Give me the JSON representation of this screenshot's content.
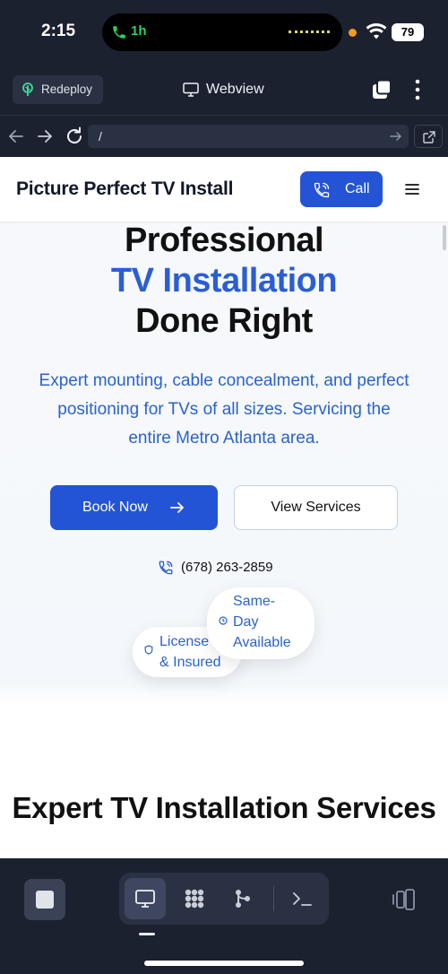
{
  "status": {
    "time": "2:15",
    "call_duration": "1h",
    "battery": "79"
  },
  "toolbar": {
    "redeploy_label": "Redeploy",
    "title": "Webview"
  },
  "urlbar": {
    "url": "/"
  },
  "site": {
    "brand": "Picture Perfect TV Install",
    "call_label": "Call",
    "hero": {
      "line1": "Professional",
      "line2": "TV Installation",
      "line3": "Done Right",
      "subtitle": "Expert mounting, cable concealment, and perfect positioning for TVs of all sizes. Servicing the entire Metro Atlanta area."
    },
    "book_label": "Book Now",
    "services_label": "View Services",
    "phone": "(678) 263-2859",
    "badge_same_day": "Same-Day Available",
    "badge_license": "License & Insured",
    "section_title": "Expert TV Installation Services"
  },
  "colors": {
    "accent": "#2454d6",
    "accent_text": "#2b62cc",
    "dark_chrome": "#1c2130"
  },
  "icons": [
    "phone-icon",
    "wifi-icon",
    "leaf-icon",
    "monitor-icon",
    "tabs-icon",
    "more-icon",
    "back-arrow-icon",
    "forward-arrow-icon",
    "reload-icon",
    "external-link-icon",
    "hamburger-icon",
    "arrow-right-icon",
    "clock-icon",
    "shield-icon",
    "stop-icon",
    "grid-icon",
    "git-icon",
    "terminal-icon",
    "panel-icon"
  ]
}
